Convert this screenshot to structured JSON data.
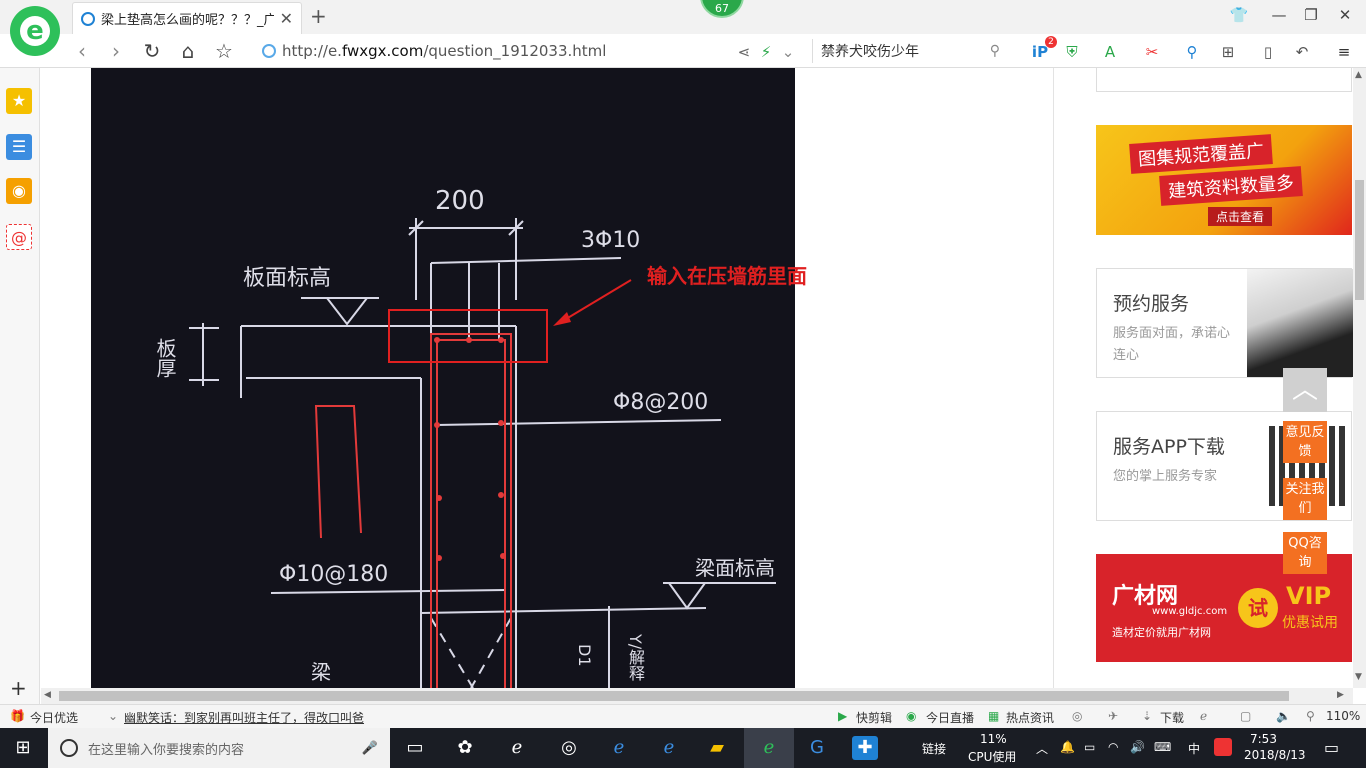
{
  "browser": {
    "tab_title": "梁上垫高怎么画的呢？？？_广联",
    "new_tab": "+",
    "badge": "67",
    "url_prefix": "http://e.",
    "url_domain": "fwxgx.com",
    "url_path": "/question_1912033.html",
    "search_text": "禁养犬咬伤少年",
    "notify_count": "2"
  },
  "drawing": {
    "dim_top": "200",
    "rebar_top": "3Φ10",
    "label_slab_elev": "板面标高",
    "label_slab_thick": "板厚",
    "rebar_stirrup": "Φ8@200",
    "rebar_bottom": "Φ10@180",
    "label_beam_elev": "梁面标高",
    "label_beam": "梁",
    "label_d": "D1",
    "label_y": "Y/解释",
    "annotation": "输入在压墙筋里面",
    "annotation_color": "#e02020"
  },
  "sidebar_right": {
    "ad1_line1": "图集规范覆盖广",
    "ad1_line2": "建筑资料数量多",
    "ad1_cta": "点击查看",
    "card1_title": "预约服务",
    "card1_sub": "服务面对面，承诺心连心",
    "card2_title": "服务APP下载",
    "card2_sub": "您的掌上服务专家",
    "ad2_brand": "广材网",
    "ad2_site": "www.gldjc.com",
    "ad2_slogan": "造材定价就用广材网",
    "ad2_try": "试",
    "ad2_vip": "VIP",
    "ad2_vip_sub": "优惠试用"
  },
  "float_buttons": {
    "feedback": "意见反馈",
    "follow": "关注我们",
    "qq": "QQ咨询"
  },
  "statusbar": {
    "today_pick": "今日优选",
    "joke": "幽默笑话：到家别再叫班主任了，得改口叫爸",
    "quick_cut": "快剪辑",
    "live": "今日直播",
    "hot_news": "热点资讯",
    "download": "下载",
    "zoom": "110%"
  },
  "taskbar": {
    "search_placeholder": "在这里输入你要搜索的内容",
    "links": "链接",
    "cpu_percent": "11%",
    "cpu_label": "CPU使用",
    "ime": "中",
    "time": "7:53",
    "date": "2018/8/13"
  }
}
